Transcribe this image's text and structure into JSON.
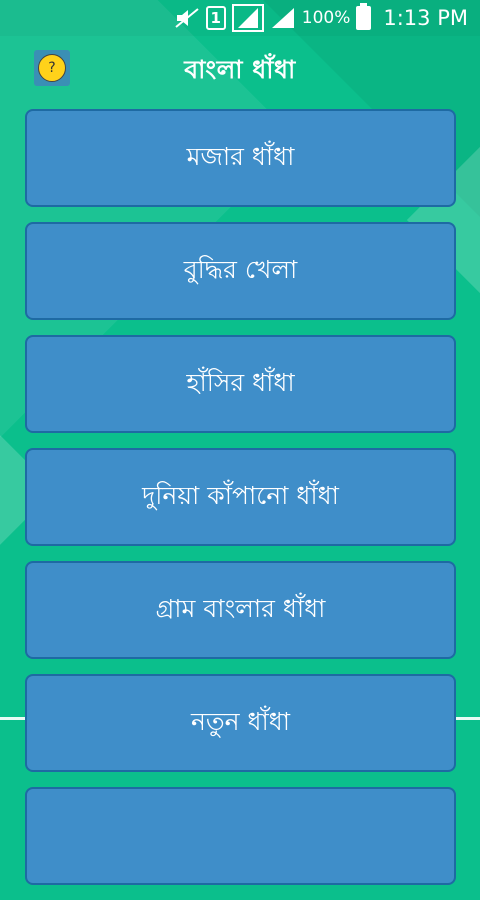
{
  "status_bar": {
    "battery": "100%",
    "time": "1:13 PM",
    "sim": "1",
    "icons": [
      "mute-icon",
      "sim-icon",
      "signal-icon",
      "signal-icon",
      "battery-icon"
    ]
  },
  "app_bar": {
    "title": "বাংলা ধাঁধা",
    "icon": "app-logo-icon"
  },
  "menu": {
    "items": [
      {
        "label": "মজার ধাঁধা"
      },
      {
        "label": "বুদ্ধির খেলা"
      },
      {
        "label": "হাঁসির ধাঁধা"
      },
      {
        "label": "দুনিয়া কাঁপানো ধাঁধা"
      },
      {
        "label": "গ্রাম বাংলার ধাঁধা"
      },
      {
        "label": "নতুন ধাঁধা"
      },
      {
        "label": ""
      }
    ]
  },
  "colors": {
    "background": "#0bbf8c",
    "button": "#3f8ec9",
    "button_border": "#1e6aa3",
    "text": "#ffffff"
  }
}
